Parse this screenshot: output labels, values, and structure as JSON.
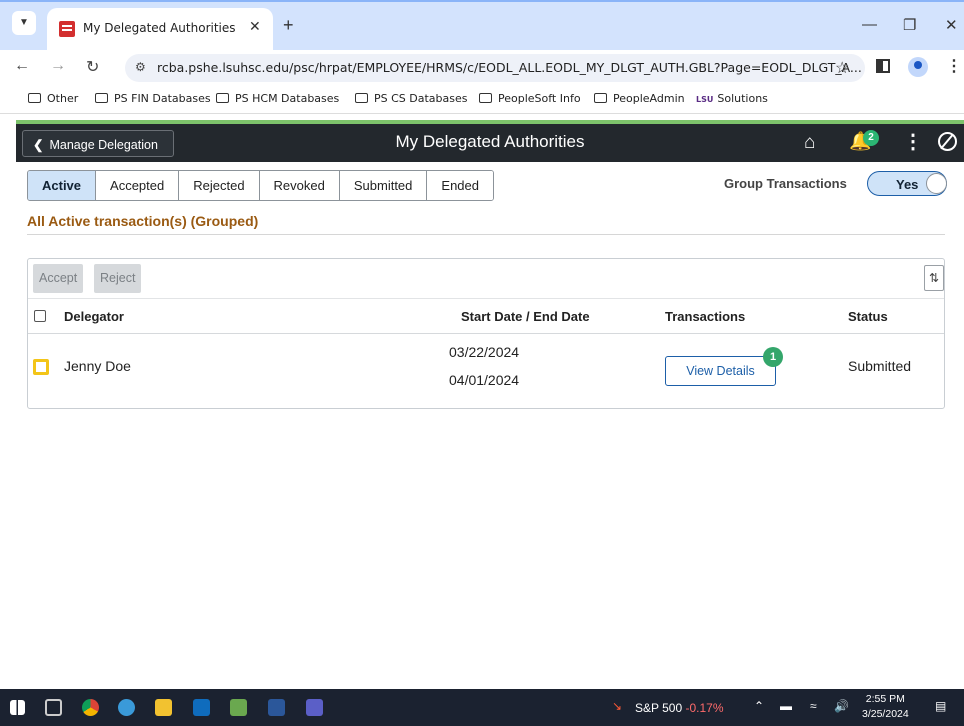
{
  "browser": {
    "tab_title": "My Delegated Authorities",
    "url": "rcba.pshe.lsuhsc.edu/psc/hrpat/EMPLOYEE/HRMS/c/EODL_ALL.EODL_MY_DLGT_AUTH.GBL?Page=EODL_DLGT_A...",
    "bookmarks": [
      "Other",
      "PS FIN Databases",
      "PS HCM Databases",
      "PS CS Databases",
      "PeopleSoft Info",
      "PeopleAdmin",
      "Solutions"
    ],
    "bookmark_lsu_logo": "LSU"
  },
  "header": {
    "back_label": "Manage Delegation",
    "title": "My Delegated Authorities",
    "notification_count": "2"
  },
  "tabs": [
    "Active",
    "Accepted",
    "Rejected",
    "Revoked",
    "Submitted",
    "Ended"
  ],
  "active_tab": "Active",
  "group_transactions": {
    "label": "Group Transactions",
    "value": "Yes"
  },
  "section_title": "All Active transaction(s) (Grouped)",
  "grid": {
    "buttons": {
      "accept": "Accept",
      "reject": "Reject"
    },
    "columns": {
      "delegator": "Delegator",
      "dates": "Start Date / End Date",
      "transactions": "Transactions",
      "status": "Status"
    },
    "rows": [
      {
        "delegator": "Jenny Doe",
        "start_date": "03/22/2024",
        "end_date": "04/01/2024",
        "transactions_button": "View Details",
        "transactions_count": "1",
        "status": "Submitted"
      }
    ]
  },
  "taskbar": {
    "ticker_name": "S&P 500",
    "ticker_delta": "-0.17%",
    "time": "2:55 PM",
    "date": "3/25/2024"
  }
}
